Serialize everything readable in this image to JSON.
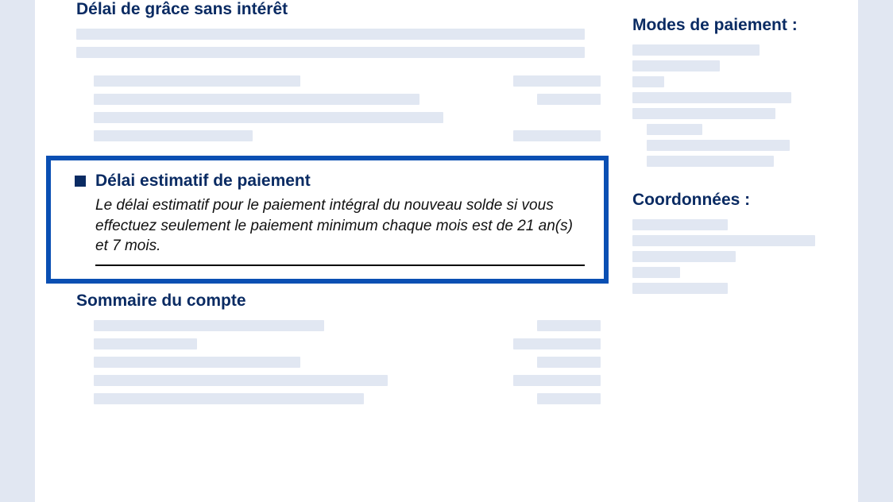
{
  "left": {
    "grace_title": "Délai de grâce sans intérêt",
    "highlight": {
      "title": "Délai estimatif de paiement",
      "body": "Le délai estimatif pour le paiement intégral du nouveau solde si vous effectuez seulement le paiement minimum chaque mois est de 21 an(s) et 7 mois."
    },
    "summary_title": "Sommaire du compte"
  },
  "right": {
    "payment_methods_title": "Modes de paiement :",
    "contact_title": "Coordonnées :"
  }
}
